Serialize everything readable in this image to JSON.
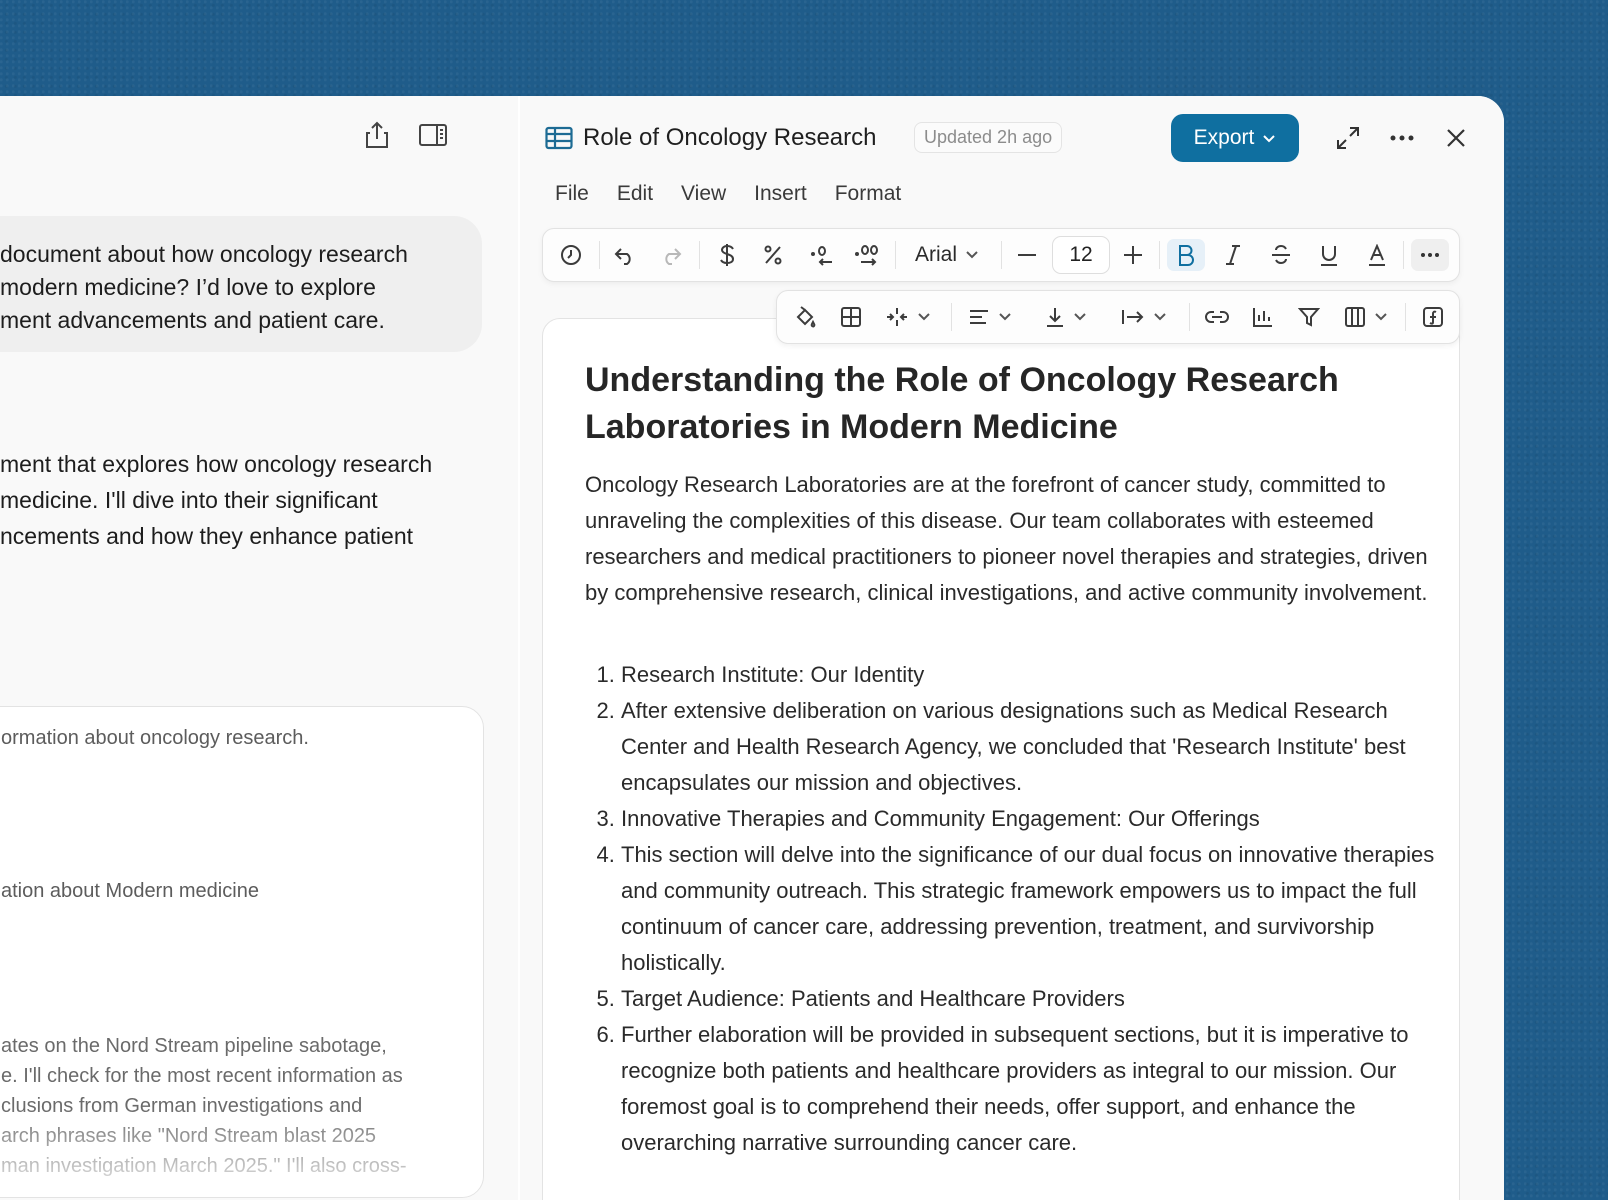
{
  "chat": {
    "user_message": "document about how oncology research\n modern medicine? I’d love to explore\nment advancements and patient care.",
    "assistant_reply": "ment that explores how oncology research\nmedicine. I'll dive into their significant\nncements and how they enhance patient",
    "tool_step_1": "ormation about oncology research.",
    "tool_step_2": "ation about Modern medicine",
    "tool_paragraph": "ates on the Nord Stream pipeline sabotage,\ne. I'll check for the most recent information as\nclusions from German investigations and\narch phrases like \"Nord Stream blast 2025\nman investigation March 2025.\" I'll also cross-"
  },
  "doc": {
    "title": "Role of Oncology Research",
    "updated": "Updated 2h ago",
    "export_label": "Export",
    "menu": [
      "File",
      "Edit",
      "View",
      "Insert",
      "Format"
    ],
    "font": "Arial",
    "font_size": "12",
    "heading": "Understanding the Role of Oncology Research Laboratories in Modern Medicine",
    "intro": "Oncology Research Laboratories are at the forefront of cancer study, committed to unraveling the complexities of this disease. Our team collaborates with esteemed researchers and medical practitioners to pioneer novel therapies and strategies, driven by comprehensive research, clinical investigations, and active community involvement.",
    "list": [
      "Research Institute: Our Identity",
      "After extensive deliberation on various designations such as Medical Research Center and Health Research Agency, we concluded that 'Research Institute' best encapsulates our mission and objectives.",
      "Innovative Therapies and Community Engagement: Our Offerings",
      "This section will delve into the significance of our dual focus on innovative therapies and community outreach. This strategic framework empowers us to impact the full continuum of cancer care, addressing prevention, treatment, and survivorship holistically.",
      "Target Audience: Patients and Healthcare Providers",
      "Further elaboration will be provided in subsequent sections, but it is imperative to recognize both patients and healthcare providers as integral to our mission. Our foremost goal is to comprehend their needs, offer support, and enhance the overarching narrative surrounding cancer care."
    ]
  },
  "colors": {
    "background": "#1f5c8a",
    "accent": "#0f6fa0",
    "active_format": "#e6f0f8"
  },
  "icons": [
    "share-icon",
    "sidebar-toggle-icon",
    "spreadsheet-icon",
    "chevron-down-icon",
    "expand-icon",
    "more-icon",
    "close-icon",
    "history-icon",
    "undo-icon",
    "redo-icon",
    "currency-icon",
    "percent-icon",
    "decrease-decimal-icon",
    "increase-decimal-icon",
    "minus-icon",
    "plus-icon",
    "bold-icon",
    "italic-icon",
    "strikethrough-icon",
    "underline-icon",
    "text-color-icon",
    "fill-color-icon",
    "borders-icon",
    "merge-cells-icon",
    "align-left-icon",
    "vertical-align-icon",
    "text-wrap-icon",
    "link-icon",
    "chart-icon",
    "filter-icon",
    "columns-icon",
    "function-icon"
  ]
}
